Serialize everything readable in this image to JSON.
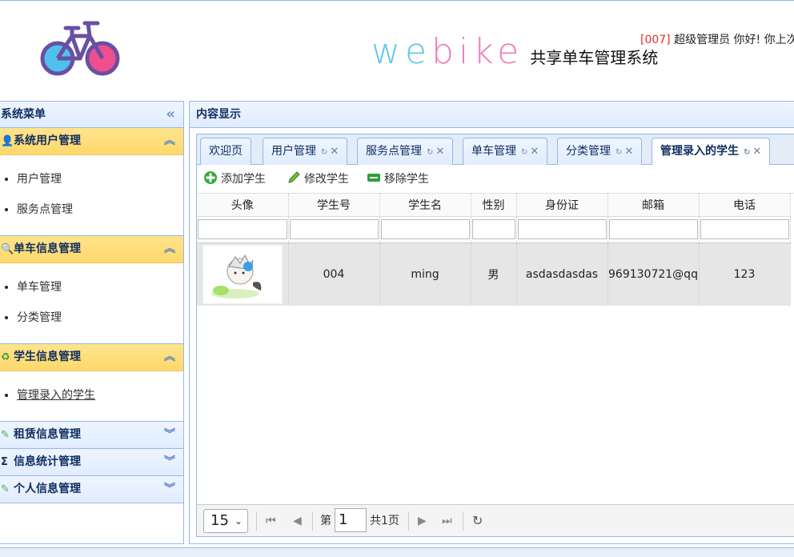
{
  "header": {
    "brand_word_a": "we",
    "brand_word_b": "bike",
    "brand_sub": "共享单车管理系统",
    "user_id": "[007]",
    "user_greeting": "超级管理员 你好! 你上次"
  },
  "west": {
    "title": "系统菜单",
    "groups": [
      {
        "label": "系统用户管理",
        "icon": "user-icon",
        "items": [
          "用户管理",
          "服务点管理"
        ]
      },
      {
        "label": "单车信息管理",
        "icon": "search-icon",
        "items": [
          "单车管理",
          "分类管理"
        ]
      },
      {
        "label": "学生信息管理",
        "icon": "refresh-icon",
        "items": [
          "管理录入的学生"
        ]
      },
      {
        "label": "租赁信息管理",
        "icon": "pencil-icon"
      },
      {
        "label": "信息统计管理",
        "icon": "sigma-icon"
      },
      {
        "label": "个人信息管理",
        "icon": "pencil-icon"
      }
    ]
  },
  "center": {
    "title": "内容显示",
    "tabs": [
      {
        "label": "欢迎页"
      },
      {
        "label": "用户管理"
      },
      {
        "label": "服务点管理"
      },
      {
        "label": "单车管理"
      },
      {
        "label": "分类管理"
      },
      {
        "label": "管理录入的学生"
      }
    ],
    "toolbar": {
      "add": "添加学生",
      "edit": "修改学生",
      "remove": "移除学生"
    },
    "grid": {
      "columns": [
        "头像",
        "学生号",
        "学生名",
        "性别",
        "身份证",
        "邮箱",
        "电话"
      ],
      "rows": [
        {
          "id": "004",
          "name": "ming",
          "gender": "男",
          "idcard": "asdasdasdas",
          "email": "969130721@qq",
          "phone": "123"
        }
      ]
    },
    "pager": {
      "page_size": "15",
      "page_prefix": "第",
      "page_value": "1",
      "page_total": "共1页"
    }
  },
  "colors": {
    "panel_border": "#95b8e7",
    "accordion_active": "#ffd86b",
    "brand_blue": "#5fc6ef",
    "brand_pink": "#f07bb8"
  }
}
